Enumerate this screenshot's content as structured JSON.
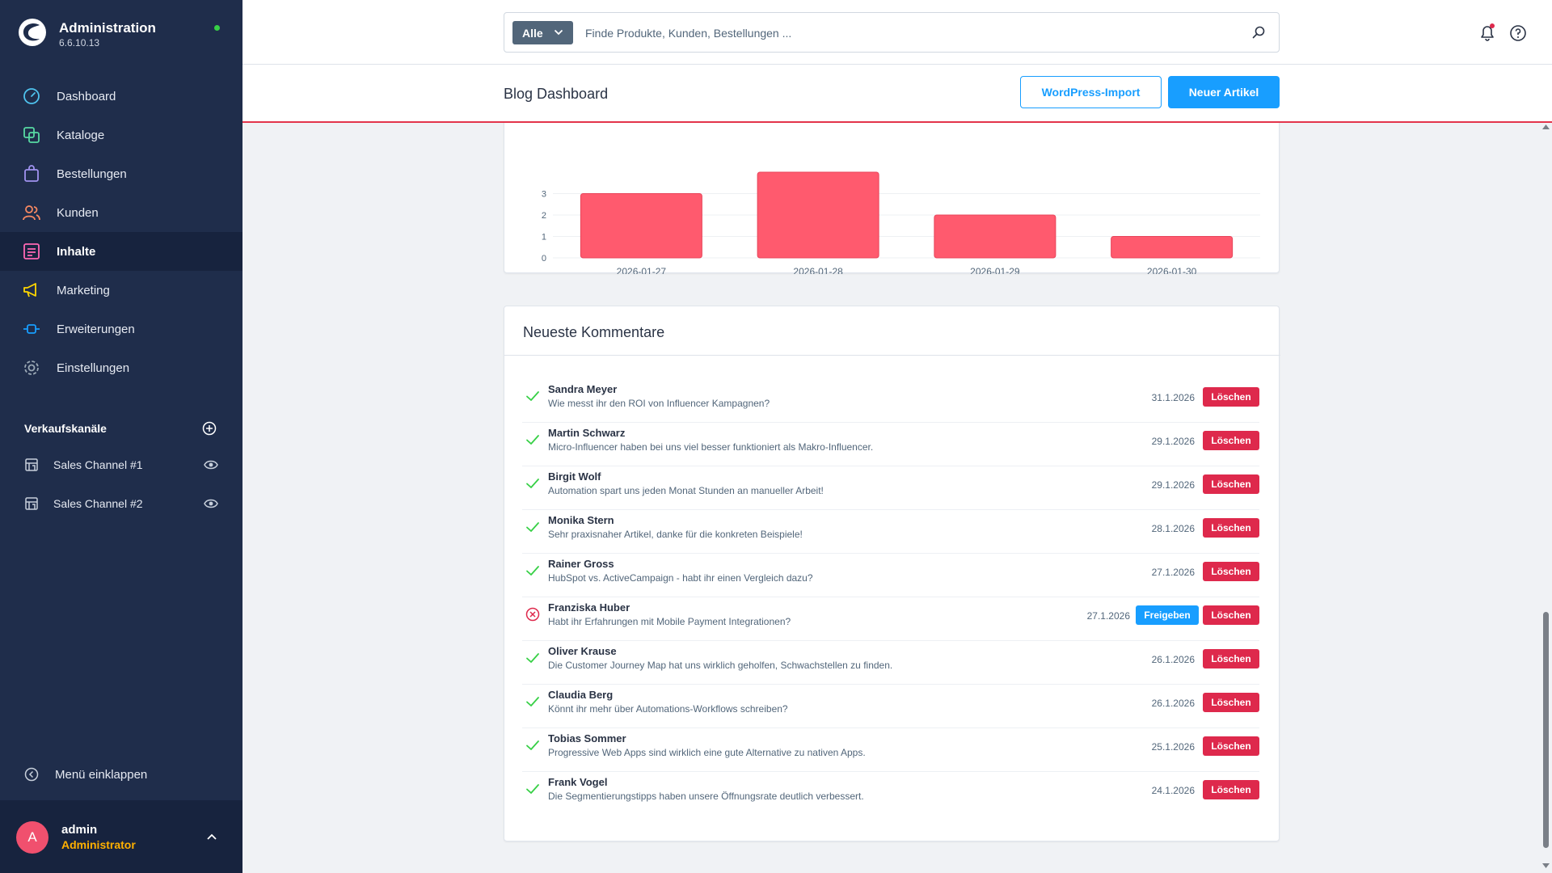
{
  "app": {
    "title": "Administration",
    "version": "6.6.10.13"
  },
  "nav": [
    {
      "label": "Dashboard",
      "icon": "gauge-icon",
      "color": "#4fc3ee"
    },
    {
      "label": "Kataloge",
      "icon": "catalog-icon",
      "color": "#57d9a3"
    },
    {
      "label": "Bestellungen",
      "icon": "shopping-bag-icon",
      "color": "#a092f0"
    },
    {
      "label": "Kunden",
      "icon": "users-icon",
      "color": "#f88962"
    },
    {
      "label": "Inhalte",
      "icon": "content-icon",
      "color": "#ff68b4",
      "active": true
    },
    {
      "label": "Marketing",
      "icon": "megaphone-icon",
      "color": "#ffd700"
    },
    {
      "label": "Erweiterungen",
      "icon": "plug-icon",
      "color": "#189eff"
    },
    {
      "label": "Einstellungen",
      "icon": "gear-icon",
      "color": "#9aa8b5"
    }
  ],
  "sales_channels": {
    "title": "Verkaufskanäle",
    "items": [
      {
        "label": "Sales Channel #1"
      },
      {
        "label": "Sales Channel #2"
      }
    ]
  },
  "collapse_label": "Menü einklappen",
  "user": {
    "initial": "A",
    "name": "admin",
    "role": "Administrator"
  },
  "search": {
    "type_label": "Alle",
    "placeholder": "Finde Produkte, Kunden, Bestellungen ..."
  },
  "smartbar": {
    "title": "Blog Dashboard",
    "import_label": "WordPress-Import",
    "new_label": "Neuer Artikel"
  },
  "chart_data": {
    "type": "bar",
    "categories": [
      "2026-01-27",
      "2026-01-28",
      "2026-01-29",
      "2026-01-30"
    ],
    "values": [
      3,
      4,
      2,
      1
    ],
    "yticks": [
      0,
      1,
      2,
      3
    ],
    "ylim": [
      0,
      4
    ],
    "color": "#ff5a6e"
  },
  "comments": {
    "title": "Neueste Kommentare",
    "delete_label": "Löschen",
    "approve_label": "Freigeben",
    "items": [
      {
        "name": "Sandra Meyer",
        "text": "Wie messt ihr den ROI von Influencer Kampagnen?",
        "date": "31.1.2026",
        "approved": true
      },
      {
        "name": "Martin Schwarz",
        "text": "Micro-Influencer haben bei uns viel besser funktioniert als Makro-Influencer.",
        "date": "29.1.2026",
        "approved": true
      },
      {
        "name": "Birgit Wolf",
        "text": "Automation spart uns jeden Monat Stunden an manueller Arbeit!",
        "date": "29.1.2026",
        "approved": true
      },
      {
        "name": "Monika Stern",
        "text": "Sehr praxisnaher Artikel, danke für die konkreten Beispiele!",
        "date": "28.1.2026",
        "approved": true
      },
      {
        "name": "Rainer Gross",
        "text": "HubSpot vs. ActiveCampaign - habt ihr einen Vergleich dazu?",
        "date": "27.1.2026",
        "approved": true
      },
      {
        "name": "Franziska Huber",
        "text": "Habt ihr Erfahrungen mit Mobile Payment Integrationen?",
        "date": "27.1.2026",
        "approved": false
      },
      {
        "name": "Oliver Krause",
        "text": "Die Customer Journey Map hat uns wirklich geholfen, Schwachstellen zu finden.",
        "date": "26.1.2026",
        "approved": true
      },
      {
        "name": "Claudia Berg",
        "text": "Könnt ihr mehr über Automations-Workflows schreiben?",
        "date": "26.1.2026",
        "approved": true
      },
      {
        "name": "Tobias Sommer",
        "text": "Progressive Web Apps sind wirklich eine gute Alternative zu nativen Apps.",
        "date": "25.1.2026",
        "approved": true
      },
      {
        "name": "Frank Vogel",
        "text": "Die Segmentierungstipps haben unsere Öffnungsrate deutlich verbessert.",
        "date": "24.1.2026",
        "approved": true
      }
    ]
  }
}
